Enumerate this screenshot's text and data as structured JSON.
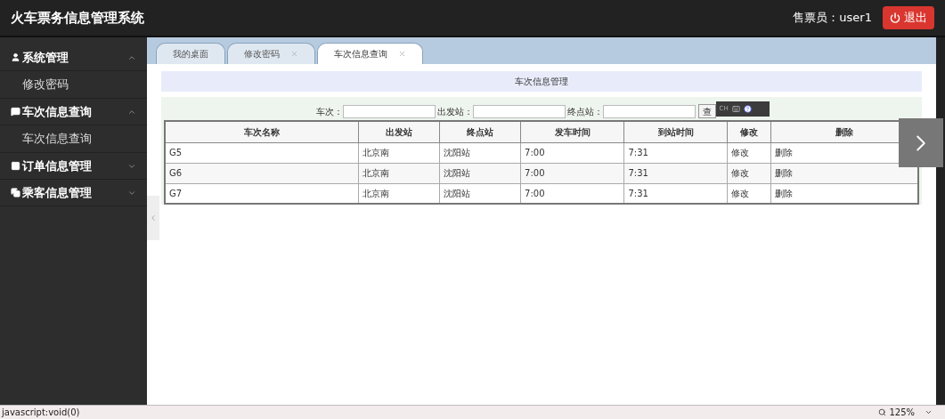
{
  "header": {
    "title": "火车票务信息管理系统",
    "user": "售票员：user1",
    "logout": "退出"
  },
  "sidebar": {
    "groups": [
      {
        "label": "系统管理",
        "expanded": true,
        "children": [
          {
            "label": "修改密码"
          }
        ]
      },
      {
        "label": "车次信息查询",
        "expanded": true,
        "children": [
          {
            "label": "车次信息查询"
          }
        ]
      },
      {
        "label": "订单信息管理",
        "expanded": false
      },
      {
        "label": "乘客信息管理",
        "expanded": false
      }
    ]
  },
  "tabs": [
    {
      "label": "我的桌面",
      "selected": false,
      "closable": false
    },
    {
      "label": "修改密码",
      "selected": false,
      "closable": true
    },
    {
      "label": "车次信息查询",
      "selected": true,
      "closable": true
    }
  ],
  "panel_title": "车次信息管理",
  "search": {
    "fields": [
      {
        "label": "车次："
      },
      {
        "label": "出发站："
      },
      {
        "label": "终点站："
      }
    ],
    "button": "查"
  },
  "ime_toolbar": {
    "label": "CH"
  },
  "table": {
    "columns": [
      "车次名称",
      "出发站",
      "终点站",
      "发车时间",
      "到站时间",
      "修改",
      "删除"
    ],
    "rows": [
      [
        "G5",
        "北京南",
        "沈阳站",
        "7:00",
        "7:31",
        "修改",
        "删除"
      ],
      [
        "G6",
        "北京南",
        "沈阳站",
        "7:00",
        "7:31",
        "修改",
        "删除"
      ],
      [
        "G7",
        "北京南",
        "沈阳站",
        "7:00",
        "7:31",
        "修改",
        "删除"
      ]
    ]
  },
  "status_bar": {
    "url": "javascript:void(0)",
    "zoom": "125%"
  }
}
